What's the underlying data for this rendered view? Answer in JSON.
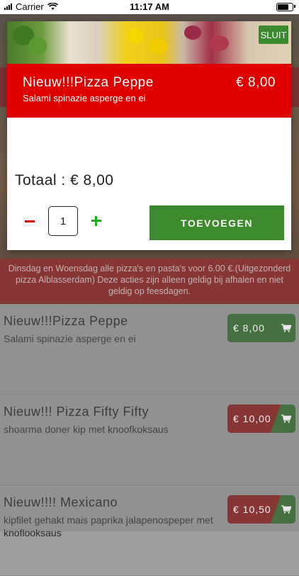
{
  "status": {
    "carrier": "Carrier",
    "time": "11:17 AM"
  },
  "modal": {
    "close_label": "SLUIT",
    "title": "Nieuw!!!Pizza Peppe",
    "price": "€ 8,00",
    "subtitle": "Salami spinazie asperge en ei",
    "total_label": "Totaal :  €  8,00",
    "quantity": "1",
    "add_label": "TOEVOEGEN"
  },
  "promo": "Dinsdag en Woensdag alle pizza's en pasta's voor 6.00 €.(Uitgezonderd pizza Alblasserdam) Deze acties zijn alleen geldig bij afhalen en niet geldig op feesdagen.",
  "menu": [
    {
      "name": "Nieuw!!!Pizza Peppe",
      "desc": "Salami spinazie asperge en ei",
      "price": "€ 8,00"
    },
    {
      "name": "Nieuw!!! Pizza Fifty Fifty",
      "desc": "shoarma doner kip met knoofkoksaus",
      "price": "€ 10,00"
    },
    {
      "name": "Nieuw!!!! Mexicano",
      "desc": "kipfilet gehakt mais paprika jalapenospeper met knoflooksaus",
      "price": "€ 10,50"
    }
  ],
  "colors": {
    "brand_red": "#e00000",
    "green": "#3c8a2e"
  }
}
